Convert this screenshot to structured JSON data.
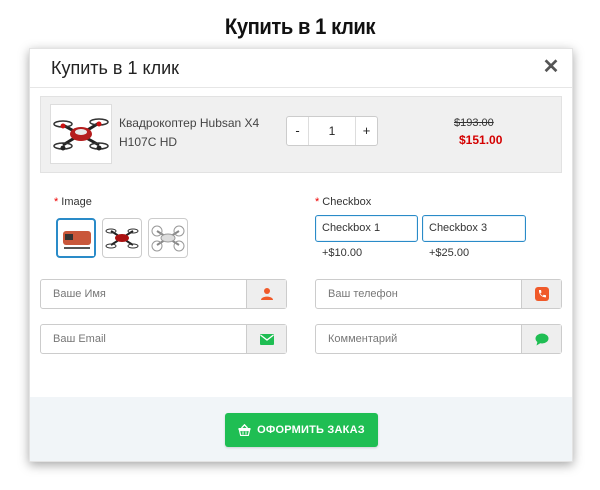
{
  "page": {
    "heading": "Купить в 1 клик"
  },
  "modal": {
    "title": "Купить в 1 клик",
    "close_glyph": "✕"
  },
  "product": {
    "name": "Квадрокоптер Hubsan X4 H107C HD",
    "quantity": "1",
    "minus_label": "-",
    "plus_label": "+",
    "old_price": "$193.00",
    "new_price": "$151.00"
  },
  "options": {
    "image": {
      "required_mark": "*",
      "label": "Image",
      "items": [
        {
          "name": "image-option-1",
          "selected": true
        },
        {
          "name": "image-option-2",
          "selected": false
        },
        {
          "name": "image-option-3",
          "selected": false
        }
      ]
    },
    "checkbox": {
      "required_mark": "*",
      "label": "Checkbox",
      "items": [
        {
          "label": "Checkbox 1  +$10.00"
        },
        {
          "label": "Checkbox 3  +$25.00"
        }
      ]
    }
  },
  "form": {
    "name": {
      "placeholder": "Ваше Имя",
      "icon": "user-icon",
      "icon_color": "#f05a2a"
    },
    "phone": {
      "placeholder": "Ваш телефон",
      "icon": "phone-icon",
      "icon_color": "#f05a2a"
    },
    "email": {
      "placeholder": "Ваш Email",
      "icon": "envelope-icon",
      "icon_color": "#1fbe53"
    },
    "comment": {
      "placeholder": "Комментарий",
      "icon": "speech-bubble-icon",
      "icon_color": "#1fbe53"
    }
  },
  "footer": {
    "order_button": "ОФОРМИТЬ ЗАКАЗ",
    "order_icon": "basket-icon"
  },
  "colors": {
    "accent_blue": "#2a8bc8",
    "order_green": "#1fbe53",
    "price_red": "#d40000",
    "icon_orange": "#f05a2a"
  }
}
